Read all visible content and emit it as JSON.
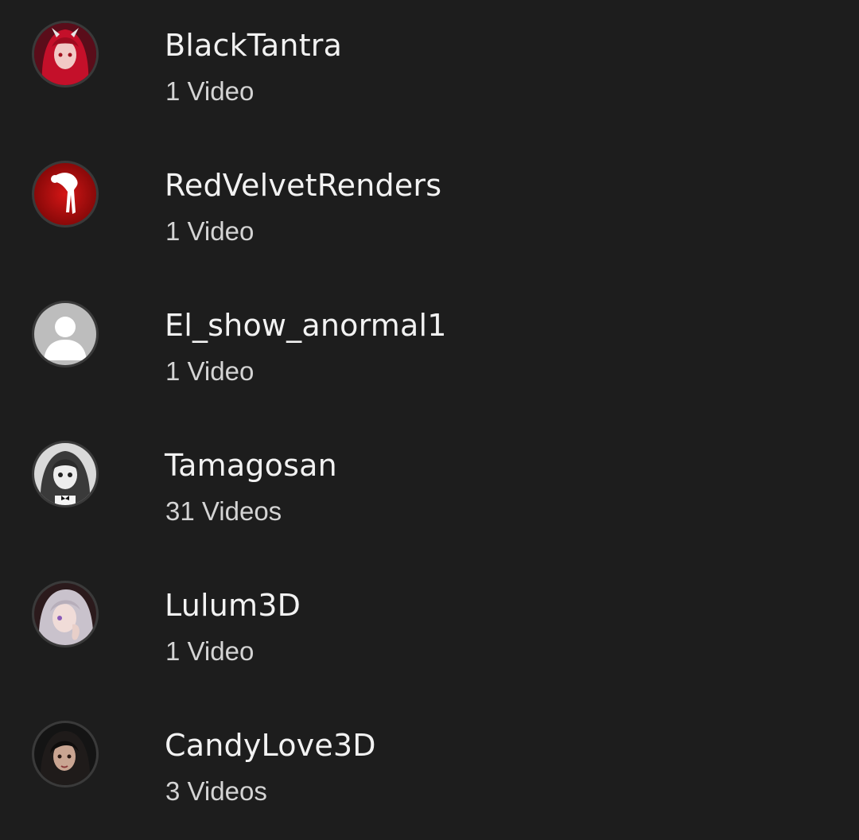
{
  "channels": [
    {
      "name": "BlackTantra",
      "count": "1 Video",
      "avatar_icon": "anime-girl-red-hair-avatar-icon",
      "accent": "#c4102a"
    },
    {
      "name": "RedVelvetRenders",
      "count": "1 Video",
      "avatar_icon": "red-silhouette-avatar-icon",
      "accent": "#b10e0e"
    },
    {
      "name": "El_show_anormal1",
      "count": "1 Video",
      "avatar_icon": "default-user-avatar-icon",
      "accent": "#bdbdbd"
    },
    {
      "name": "Tamagosan",
      "count": "31 Videos",
      "avatar_icon": "grayscale-character-avatar-icon",
      "accent": "#9a9a9a"
    },
    {
      "name": "Lulum3D",
      "count": "1 Video",
      "avatar_icon": "white-hair-character-avatar-icon",
      "accent": "#8a7f8c"
    },
    {
      "name": "CandyLove3D",
      "count": "3 Videos",
      "avatar_icon": "dark-hair-character-avatar-icon",
      "accent": "#3a2c2a"
    }
  ]
}
